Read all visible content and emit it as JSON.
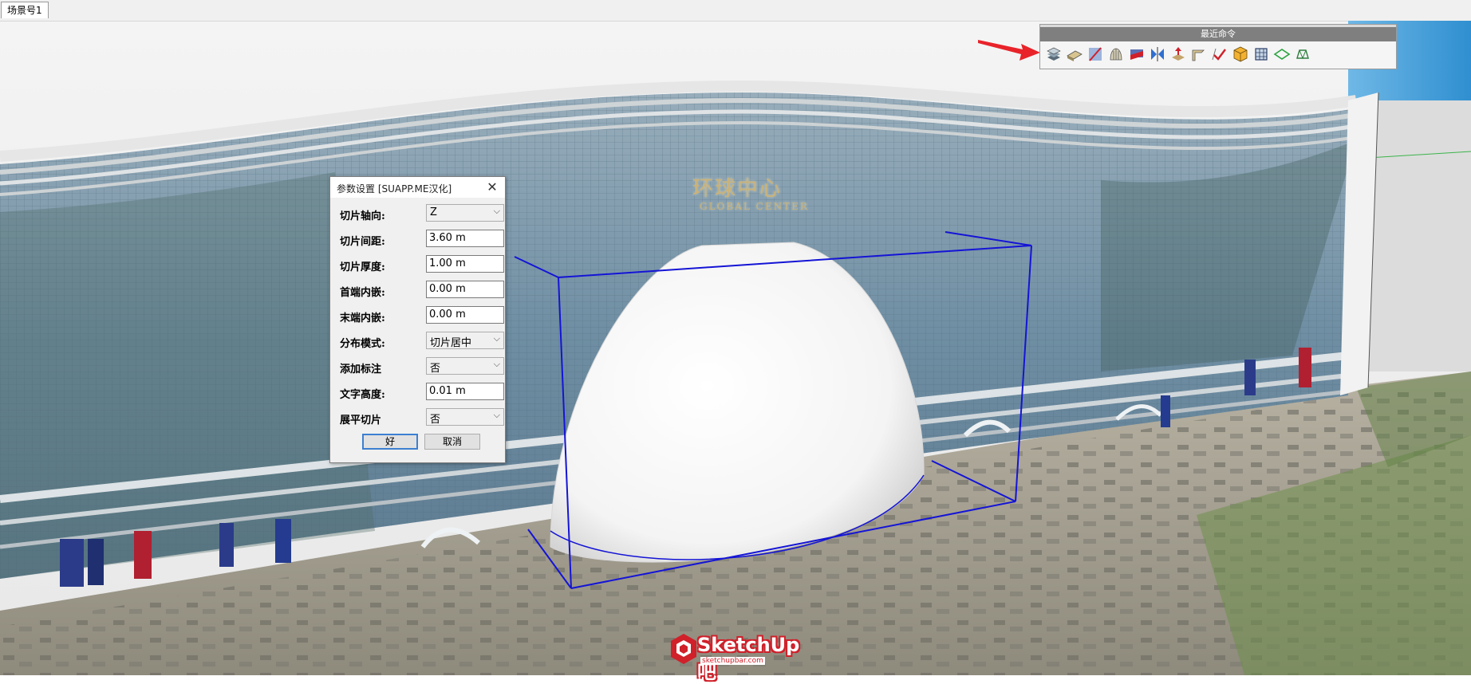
{
  "scene_tabs": [
    "场景号1"
  ],
  "building_sign": {
    "chinese": "环球中心",
    "english": "GLOBAL CENTER"
  },
  "toolbar": {
    "title": "最近命令",
    "icons": [
      "layered-slice-icon",
      "profile-slab-icon",
      "slash-plane-icon",
      "shell-icon",
      "section-red-icon",
      "mirror-blue-icon",
      "push-red-icon",
      "fold-surface-icon",
      "checkmark-icon",
      "orange-cube-icon",
      "grid-frame-icon",
      "green-plane-icon",
      "wire-shape-icon"
    ]
  },
  "dialog": {
    "title": "参数设置 [SUAPP.ME汉化]",
    "fields": [
      {
        "label": "切片轴向:",
        "type": "select",
        "value": "Z"
      },
      {
        "label": "切片间距:",
        "type": "text",
        "value": "3.60 m"
      },
      {
        "label": "切片厚度:",
        "type": "text",
        "value": "1.00 m"
      },
      {
        "label": "首端内嵌:",
        "type": "text",
        "value": "0.00 m"
      },
      {
        "label": "末端内嵌:",
        "type": "text",
        "value": "0.00 m"
      },
      {
        "label": "分布模式:",
        "type": "select",
        "value": "切片居中"
      },
      {
        "label": "添加标注",
        "type": "select",
        "value": "否"
      },
      {
        "label": "文字高度:",
        "type": "text",
        "value": "0.01 m"
      },
      {
        "label": "展平切片",
        "type": "select",
        "value": "否"
      }
    ],
    "ok_label": "好",
    "cancel_label": "取消"
  },
  "watermark": {
    "text": "SketchUp吧",
    "sub": "sketchupbar.com"
  },
  "colors": {
    "bounding_box": "#1414d6",
    "dialog_focus": "#3c7fd1",
    "watermark": "#d0202a"
  }
}
